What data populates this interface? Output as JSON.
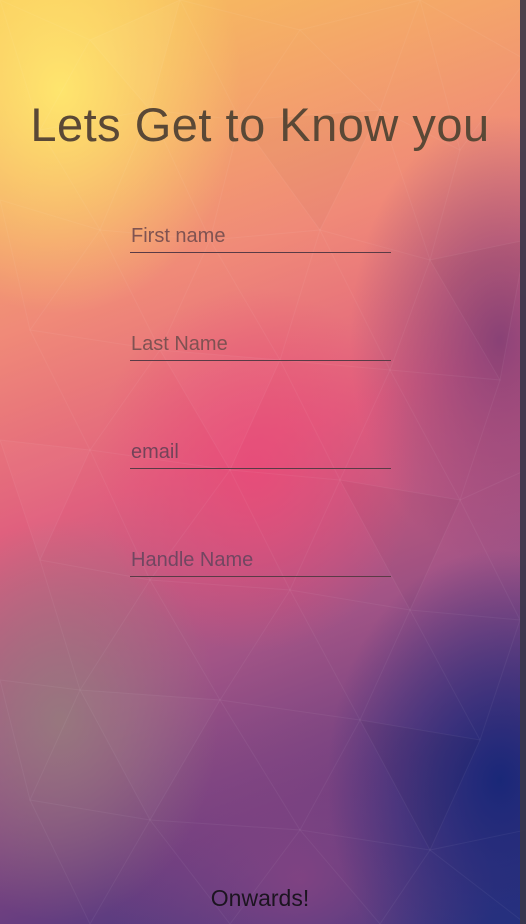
{
  "form": {
    "title": "Lets Get to Know you",
    "fields": [
      {
        "placeholder": "First name",
        "value": ""
      },
      {
        "placeholder": "Last Name",
        "value": ""
      },
      {
        "placeholder": "email",
        "value": ""
      },
      {
        "placeholder": "Handle Name",
        "value": ""
      }
    ],
    "submit_label": "Onwards!"
  },
  "colors": {
    "title_text": "#5a4836",
    "field_underline": "#5a3b46",
    "button_text": "#1c1420",
    "background_top_left": "#f8c45a",
    "background_center": "#e0607e",
    "background_bottom_right": "#2b3582"
  }
}
